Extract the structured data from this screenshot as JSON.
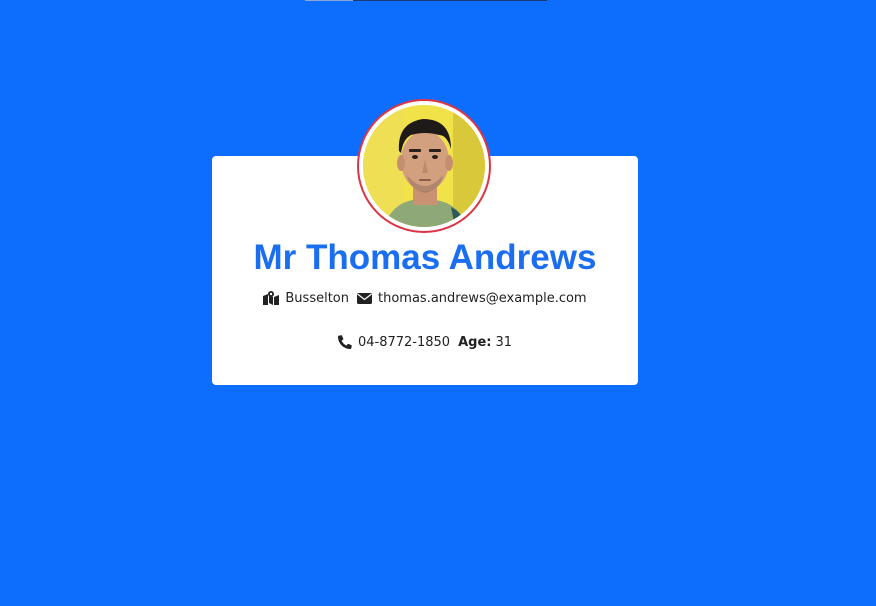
{
  "profile": {
    "name": "Mr Thomas Andrews",
    "city": "Busselton",
    "email": "thomas.andrews@example.com",
    "phone": "04-8772-1850",
    "age_label": "Age:",
    "age": "31",
    "avatar_icon": "user-photo"
  },
  "colors": {
    "background": "#0d6efd",
    "name": "#1a6eef",
    "avatar_border": "#dc3545",
    "card": "#ffffff"
  }
}
